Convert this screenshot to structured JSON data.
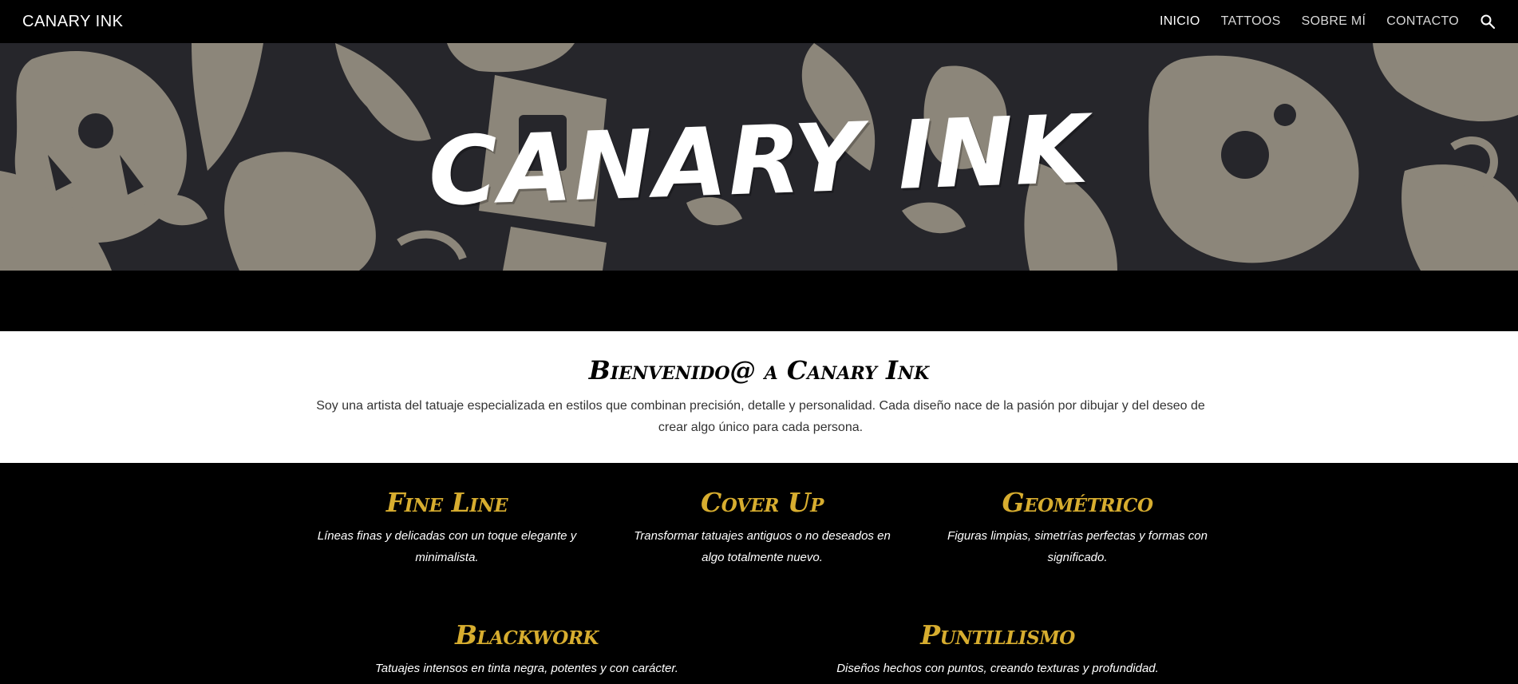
{
  "nav": {
    "brand": "CANARY INK",
    "links": [
      {
        "label": "INICIO",
        "active": true
      },
      {
        "label": "TATTOOS",
        "active": false
      },
      {
        "label": "SOBRE MÍ",
        "active": false
      },
      {
        "label": "CONTACTO",
        "active": false
      }
    ],
    "search_icon": "search-icon"
  },
  "hero": {
    "title": "CANARY INK"
  },
  "intro": {
    "title": "Bienvenido@ a Canary Ink",
    "text": "Soy una artista del tatuaje especializada en estilos que combinan precisión, detalle y personalidad. Cada diseño nace de la pasión por dibujar y del deseo de crear algo único para cada persona."
  },
  "styles": [
    {
      "title": "Fine Line",
      "desc": "Líneas finas y delicadas con un toque elegante y minimalista."
    },
    {
      "title": "Cover Up",
      "desc": "Transformar tatuajes antiguos o no deseados en algo totalmente nuevo."
    },
    {
      "title": "Geométrico",
      "desc": "Figuras limpias, simetrías perfectas y formas con significado."
    },
    {
      "title": "Blackwork",
      "desc": "Tatuajes intensos en tinta negra, potentes y con carácter."
    },
    {
      "title": "Puntillismo",
      "desc": "Diseños hechos con puntos, creando texturas y profundidad."
    }
  ],
  "colors": {
    "accent": "#d7ad2f",
    "hero_pattern": "#8c867a",
    "hero_bg": "#26262b"
  }
}
